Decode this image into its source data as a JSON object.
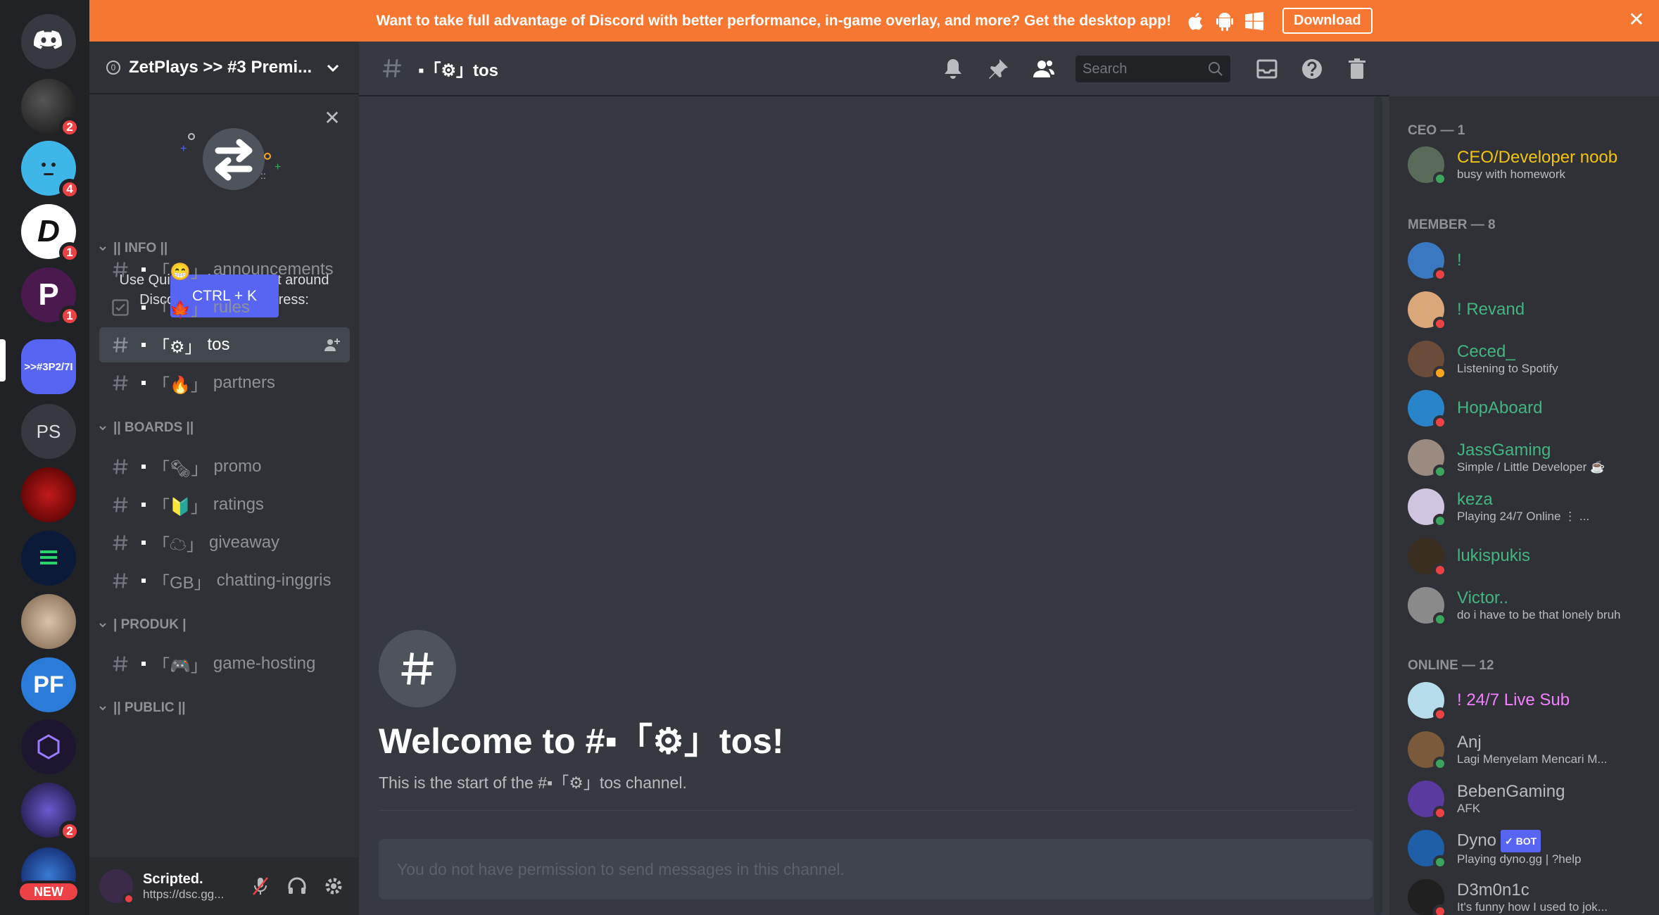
{
  "banner": {
    "message": "Want to take full advantage of Discord with better performance, in-game overlay, and more? Get the desktop app!",
    "download_label": "Download",
    "bg_color": "#f57731"
  },
  "servers": [
    {
      "id": "home",
      "label": "",
      "badge": ""
    },
    {
      "id": "s1",
      "label": "",
      "badge": "2"
    },
    {
      "id": "s2",
      "label": "",
      "badge": "4"
    },
    {
      "id": "s3",
      "label": "",
      "badge": "1"
    },
    {
      "id": "s4",
      "label": "",
      "badge": "1"
    },
    {
      "id": "s5",
      "label": ">>#3P2/7I",
      "badge": ""
    },
    {
      "id": "s6",
      "label": "PS",
      "badge": ""
    },
    {
      "id": "s7",
      "label": "",
      "badge": ""
    },
    {
      "id": "s8",
      "label": "",
      "badge": ""
    },
    {
      "id": "s9",
      "label": "",
      "badge": ""
    },
    {
      "id": "s10",
      "label": "PF",
      "badge": ""
    },
    {
      "id": "s11",
      "label": "",
      "badge": ""
    },
    {
      "id": "s12",
      "label": "",
      "badge": "2"
    },
    {
      "id": "s13",
      "label": "",
      "badge": ""
    }
  ],
  "new_badge": "NEW",
  "guild": {
    "name": "ZetPlays >> #3 Premi...",
    "boost_level": "0"
  },
  "quick_switcher": {
    "text": "Use Quick Switcher to get around Discord quickly. Just press:",
    "button": "CTRL + K"
  },
  "categories": [
    {
      "name": "|| INFO ||"
    },
    {
      "name": "|| BOARDS ||"
    },
    {
      "name": "| PRODUK |"
    },
    {
      "name": "|| PUBLIC ||"
    }
  ],
  "channels": [
    {
      "emoji": "「😁」",
      "name": "announcements"
    },
    {
      "emoji": "「🍁」",
      "name": "rules"
    },
    {
      "emoji": "「⚙」",
      "name": "tos"
    },
    {
      "emoji": "「🔥」",
      "name": "partners"
    },
    {
      "emoji": "「🗞」",
      "name": "promo"
    },
    {
      "emoji": "「🔰」",
      "name": "ratings"
    },
    {
      "emoji": "「☁」",
      "name": "giveaway"
    },
    {
      "emoji": "「GB」",
      "name": "chatting-inggris"
    },
    {
      "emoji": "「🎮」",
      "name": "game-hosting"
    }
  ],
  "user": {
    "name": "Scripted.",
    "status": "https://dsc.gg..."
  },
  "chat": {
    "channel_title": "▪「⚙」tos",
    "search_placeholder": "Search",
    "welcome_title": "Welcome to #▪「⚙」tos!",
    "welcome_sub": "This is the start of the #▪「⚙」tos channel.",
    "composer_placeholder": "You do not have permission to send messages in this channel."
  },
  "member_groups": [
    {
      "label": "CEO — 1"
    },
    {
      "label": "MEMBER — 8"
    },
    {
      "label": "ONLINE — 12"
    }
  ],
  "members": [
    {
      "name": "CEO/Developer noob",
      "color": "#f1c40f",
      "status": "online",
      "activity": "busy with homework",
      "av": "#5a6b5a"
    },
    {
      "name": "!",
      "color": "#43b581",
      "status": "dnd",
      "activity": "",
      "av": "#3a78c2"
    },
    {
      "name": "! Revand",
      "color": "#43b581",
      "status": "dnd",
      "activity": "",
      "av": "#d9a77a"
    },
    {
      "name": "Ceced_",
      "color": "#43b581",
      "status": "idle",
      "activity": "Listening to Spotify",
      "av": "#6b4b3a"
    },
    {
      "name": "HopAboard",
      "color": "#43b581",
      "status": "dnd",
      "activity": "",
      "av": "#2a84c9"
    },
    {
      "name": "JassGaming",
      "color": "#43b581",
      "status": "online",
      "activity": "Simple / Little Developer ☕",
      "av": "#9a8a80"
    },
    {
      "name": "keza",
      "color": "#43b581",
      "status": "online",
      "activity": "Playing 24/7 Online ⋮ ...",
      "av": "#d0c5e0"
    },
    {
      "name": "lukispukis",
      "color": "#43b581",
      "status": "dnd",
      "activity": "",
      "av": "#3a2e20"
    },
    {
      "name": "Victor..",
      "color": "#43b581",
      "status": "online",
      "activity": "do i have to be that lonely bruh",
      "av": "#8a8a8a"
    },
    {
      "name": "! 24/7 Live Sub",
      "color": "#f47fff",
      "status": "dnd",
      "activity": "",
      "av": "#b7dceb"
    },
    {
      "name": "Anj",
      "color": "#b9bbbe",
      "status": "online",
      "activity": "Lagi Menyelam Mencari M...",
      "av": "#7a5a3a"
    },
    {
      "name": "BebenGaming",
      "color": "#b9bbbe",
      "status": "dnd",
      "activity": "AFK",
      "av": "#5b3aa0"
    },
    {
      "name": "Dyno",
      "color": "#b9bbbe",
      "status": "online",
      "activity": "Playing dyno.gg | ?help",
      "av": "#1f5fa8",
      "bot": "✓ BOT"
    },
    {
      "name": "D3m0n1c",
      "color": "#b9bbbe",
      "status": "dnd",
      "activity": "It's funny how I used to jok...",
      "av": "#202020"
    }
  ]
}
